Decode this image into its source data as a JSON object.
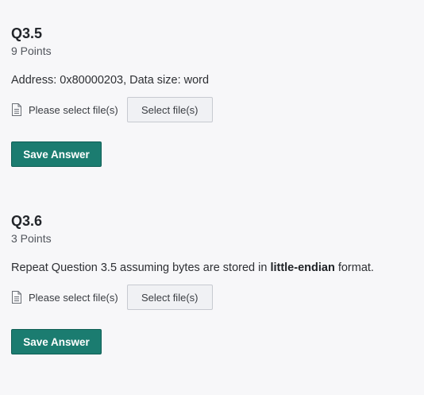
{
  "questions": [
    {
      "title": "Q3.5",
      "points": "9 Points",
      "prompt_text": "Address: 0x80000203, Data size: word",
      "file_status": "Please select file(s)",
      "select_label": "Select file(s)",
      "save_label": "Save Answer"
    },
    {
      "title": "Q3.6",
      "points": "3 Points",
      "prompt_before": "Repeat Question 3.5 assuming bytes are stored in ",
      "prompt_bold": "little-endian",
      "prompt_after": " format.",
      "file_status": "Please select file(s)",
      "select_label": "Select file(s)",
      "save_label": "Save Answer"
    }
  ],
  "icons": {
    "file": "file-icon"
  },
  "colors": {
    "save_button_bg": "#1b7c70",
    "page_bg": "#f7f7f9"
  }
}
